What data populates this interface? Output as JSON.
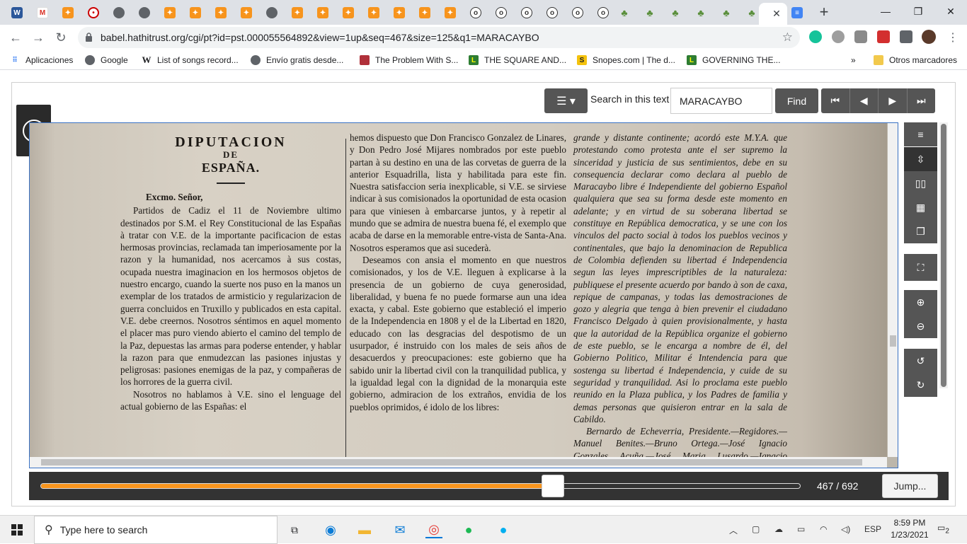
{
  "browser": {
    "url": "babel.hathitrust.org/cgi/pt?id=pst.000055564892&view=1up&seq=467&size=125&q1=MARACAYBO",
    "bookmarks": [
      {
        "label": "Aplicaciones"
      },
      {
        "label": "Google"
      },
      {
        "label": "List of songs record..."
      },
      {
        "label": "Envío gratis desde..."
      },
      {
        "label": "The Problem With S..."
      },
      {
        "label": "THE SQUARE AND..."
      },
      {
        "label": "Snopes.com | The d..."
      },
      {
        "label": "GOVERNING THE..."
      },
      {
        "label": "Otros marcadores"
      }
    ],
    "overflow_label": "»",
    "new_tab": "+",
    "close_tab": "✕"
  },
  "reader": {
    "search_label": "Search in this text",
    "search_value": "MARACAYBO",
    "find_label": "Find",
    "page_current": "467",
    "page_sep": " / ",
    "page_total": "692",
    "jump_label": "Jump...",
    "progress_fraction": 0.6749
  },
  "document": {
    "heading1": "DIPUTACION",
    "heading2": "DE",
    "heading3": "ESPAÑA.",
    "salutation": "Excmo. Señor,",
    "col1_p1": "Partidos de Cadiz el 11 de Noviembre ultimo destinados por S.M. el Rey Constitucional de las Españas à tratar con V.E. de la importante pacificacion de estas hermosas provincias, reclamada tan imperiosamente por la razon y la humanidad, nos acercamos à sus costas, ocupada nuestra imaginacion en los hermosos objetos de nuestro encargo, cuando la suerte nos puso en la manos un exemplar de los tratados de armisticio y regularizacion de guerra concluidos en Truxillo y publicados en esta capital. V.E. debe creernos. Nosotros séntimos en aquel momento el placer mas puro viendo abierto el camino del templo de la Paz, depuestas las armas para poderse entender, y hablar la razon para que enmudezcan las pasiones injustas y peligrosas: pasiones enemigas de la paz, y compañeras de los horrores de la guerra civil.",
    "col1_p2": "Nosotros no hablamos à V.E. sino el lenguage del actual gobierno de las Españas: el",
    "col2_p1": "hemos dispuesto que Don Francisco Gonzalez de Linares, y Don Pedro José Mijares nombrados por este pueblo partan à su destino en una de las corvetas de guerra de la anterior Esquadrilla, lista y habilitada para este fin. Nuestra satisfaccion seria inexplicable, si V.E. se sirviese indicar à sus comisionados la oportunidad de esta ocasion para que viniesen à embarcarse juntos, y à repetir al mundo que se admira de nuestra buena fé, el exemplo que acaba de darse en la memorable entre-vista de Santa-Ana. Nosotros esperamos que asi sucederà.",
    "col2_p2": "Deseamos con ansia el momento en que nuestros comisionados, y los de V.E. lleguen à explicarse à la presencia de un gobierno de cuya generosidad, liberalidad, y buena fe no puede formarse aun una idea exacta, y cabal. Este gobierno que estableció el imperio de la Independencia en 1808 y el de la Libertad en 1820, educado con las desgracias del despotismo de un usurpador, é instruido con los males de seis años de desacuerdos y preocupaciones: este gobierno que ha sabido unir la libertad civil con la tranquilidad publica, y la igualdad legal con la dignidad de la monarquia este gobierno, admiracion de los extraños, envidia de los pueblos oprimidos, é idolo de los libres:",
    "col3_p1": "grande y distante continente; acordó este M.Y.A. que protestando como protesta ante el ser supremo la sinceridad y justicia de sus sentimientos, debe en su consequencia declarar como declara al pueblo de Maracaybo libre é Independiente del gobierno Español qualquiera que sea su forma desde este momento en adelante; y en virtud de su soberana libertad se constituye en República democratica, y se une con los vinculos del pacto social à todos los pueblos vecinos y continentales, que bajo la denominacion de Republica de Colombia defienden su libertad é Independencia segun las leyes imprescriptibles de la naturaleza: publiquese el presente acuerdo por bando à son de caxa, repique de campanas, y todas las demostraciones de gozo y alegria que tenga à bien prevenir el ciudadano Francisco Delgado à quien provisionalmente, y hasta que la autoridad de la República organize el gobierno de este pueblo, se le encarga a nombre de él, del Gobierno Politico, Militar é Intendencia para que sostenga su libertad é Independencia, y cuide de su seguridad y tranquilidad. Asi lo proclama este pueblo reunido en la Plaza publica, y los Padres de familia y demas personas que quisieron entrar en la sala de Cabildo.",
    "col3_p2": "Bernardo de Echeverria, Presidente.—Regidores.—Manuel Benites.—Bruno Ortega.—José Ignacio Gonzales Acuña.—José Maria Lusardo.—Ignacio Palenzuela.—Miguel Vera.— Manuel"
  },
  "taskbar": {
    "search_placeholder": "Type here to search",
    "lang": "ESP",
    "time": "8:59 PM",
    "date": "1/23/2021",
    "notifications": "2"
  },
  "colors": {
    "accent": "#f7941d",
    "toolbar_button": "#555555",
    "viewer_border": "#3a72c4"
  }
}
